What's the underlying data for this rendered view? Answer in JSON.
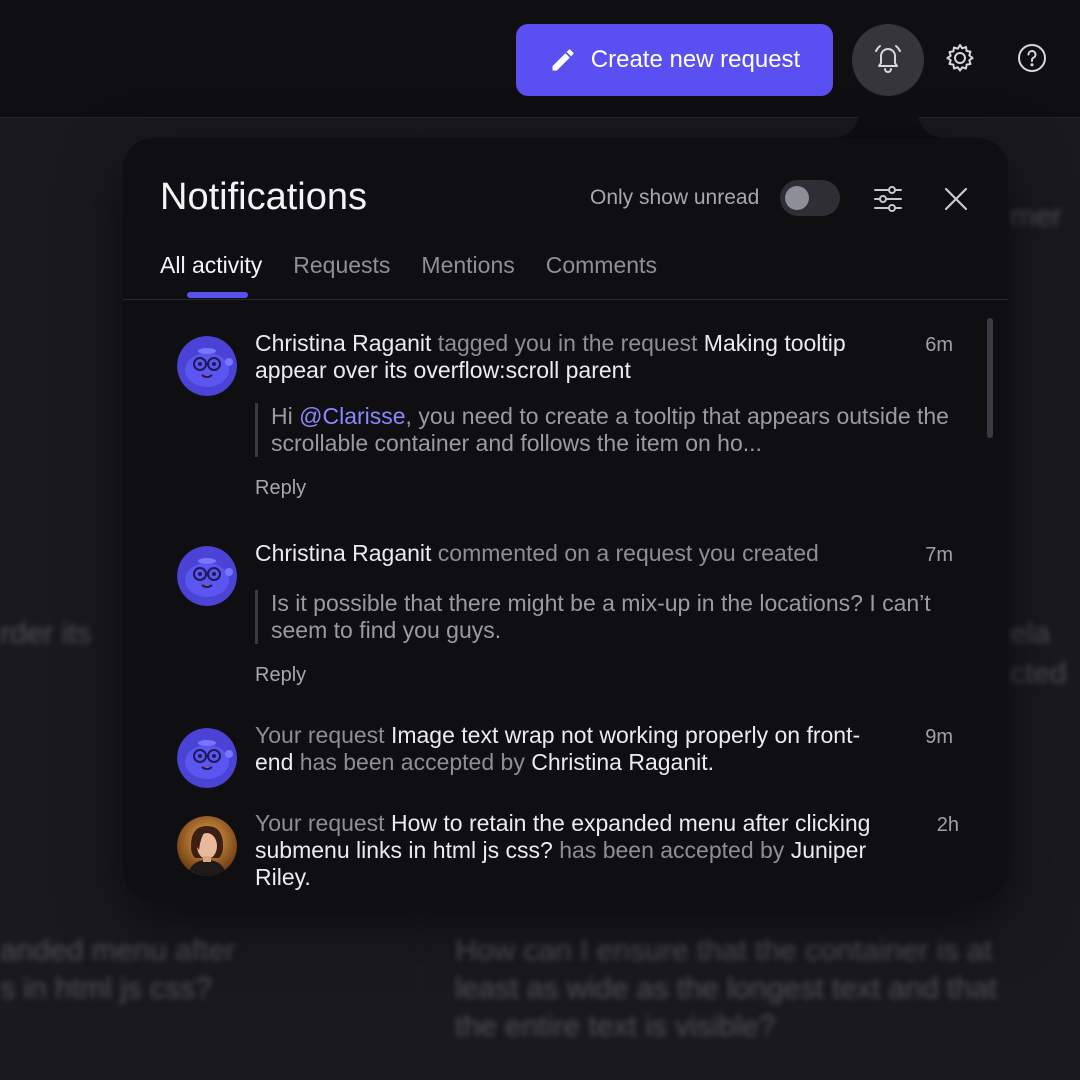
{
  "toolbar": {
    "create_label": "Create new request",
    "icons": [
      "pencil-icon",
      "bell-icon",
      "gear-icon",
      "help-icon"
    ]
  },
  "background_text": {
    "left_1": "rder its",
    "left_2": "anded menu after",
    "left_3": "s in html js css?",
    "right_1": "mer",
    "right_2": "ela",
    "right_3": "cted",
    "right_4": "How can I ensure that the container is at",
    "right_5": "least as wide as the longest text and that",
    "right_6": "the entire text is visible?"
  },
  "panel": {
    "title": "Notifications",
    "unread_label": "Only show unread",
    "unread_enabled": false,
    "tabs": [
      {
        "label": "All activity",
        "active": true
      },
      {
        "label": "Requests",
        "active": false
      },
      {
        "label": "Mentions",
        "active": false
      },
      {
        "label": "Comments",
        "active": false
      }
    ]
  },
  "notifications": [
    {
      "actor": "Christina Raganit",
      "verb": " tagged you in the request ",
      "subject": "Making tooltip appear over its overflow:scroll parent",
      "time": "6m",
      "quote_pre": "Hi ",
      "quote_mention": "@Clarisse",
      "quote_post": ", you need to create a tooltip that appears outside the scrollable container and follows the item on ho...",
      "reply": "Reply"
    },
    {
      "actor": "Christina Raganit",
      "verb": " commented on a request you created",
      "time": "7m",
      "quote": "Is it possible that there might be a mix-up in the locations? I can’t seem to find you guys.",
      "reply": "Reply"
    },
    {
      "prefix": "Your request ",
      "subject": "Image text wrap not working properly on front-end",
      "mid": " has been accepted by ",
      "actor": "Christina Raganit.",
      "time": "9m"
    },
    {
      "prefix": "Your request ",
      "subject": "How to retain the expanded menu after clicking submenu links in html js css?",
      "mid": " has been accepted by ",
      "actor": "Juniper Riley.",
      "time": "2h"
    }
  ],
  "colors": {
    "accent": "#5a4ff0",
    "mention": "#8c86ff",
    "panel_bg": "#0f0f12"
  }
}
